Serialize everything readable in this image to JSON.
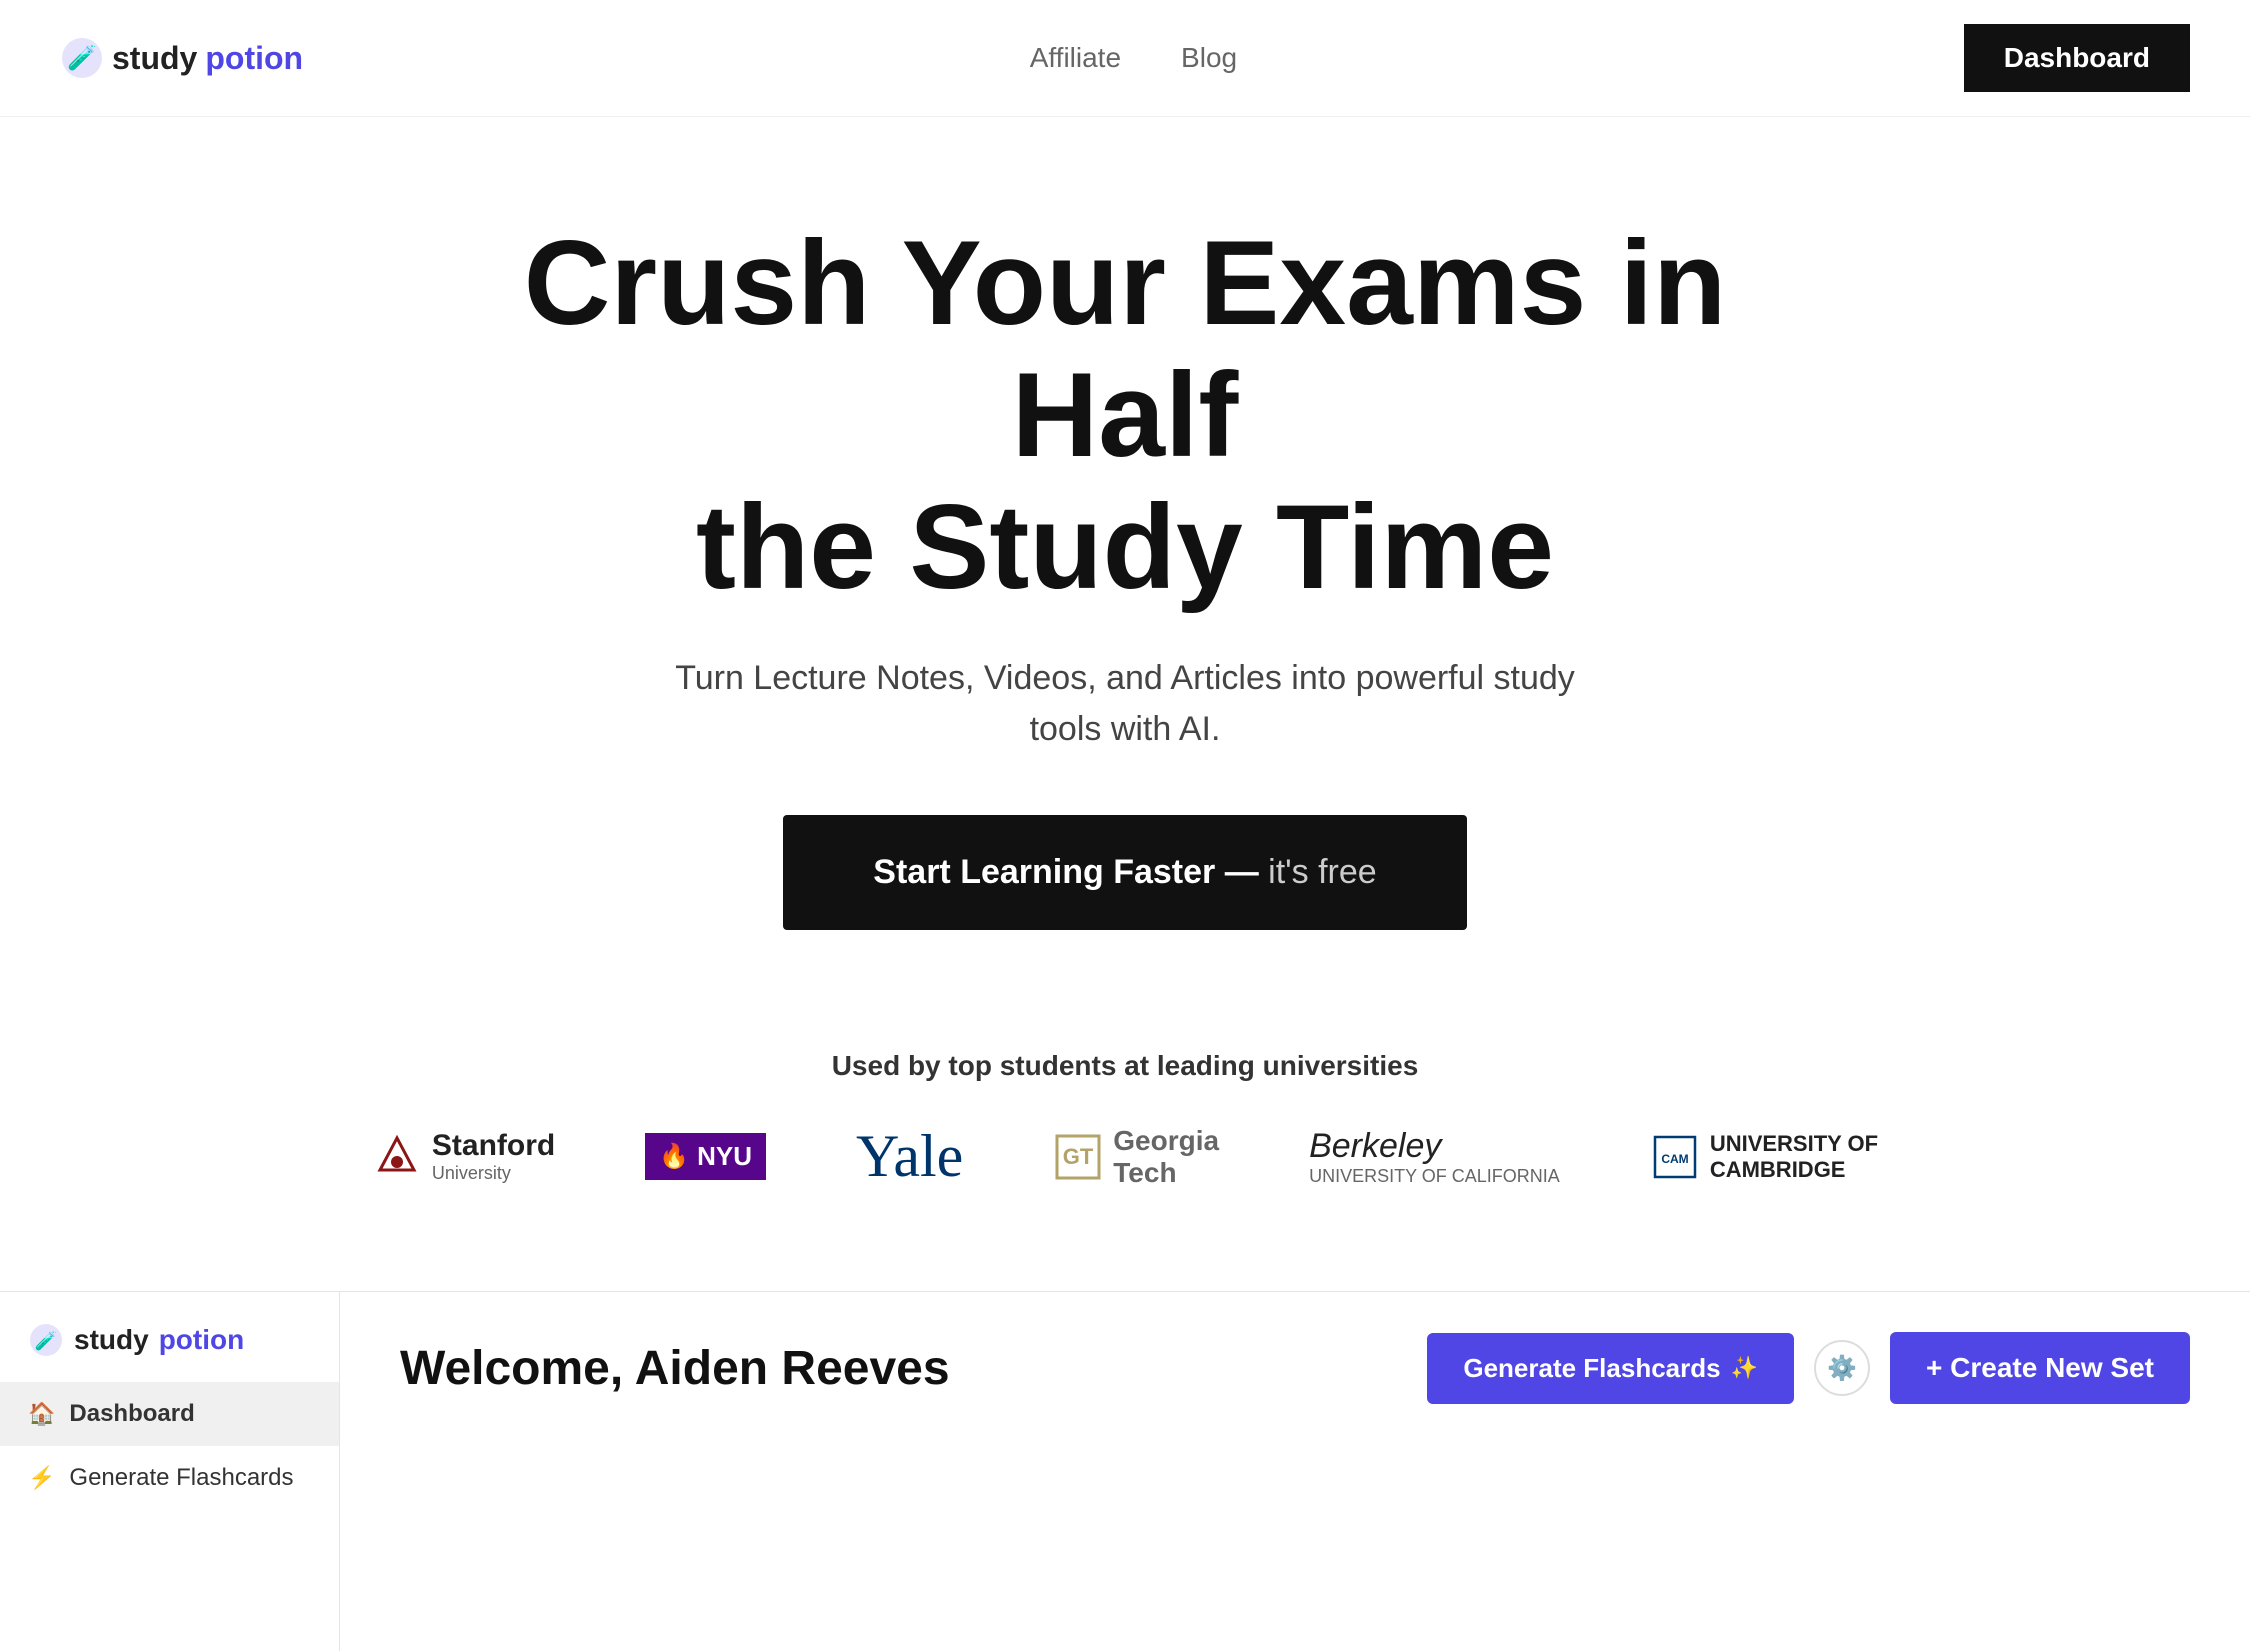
{
  "nav": {
    "logo_study": "study",
    "logo_potion": "potion",
    "link_affiliate": "Affiliate",
    "link_blog": "Blog",
    "dashboard_btn": "Dashboard"
  },
  "hero": {
    "title_line1": "Crush Your Exams in Half",
    "title_line2": "the Study Time",
    "subtitle": "Turn Lecture Notes, Videos, and Articles into powerful study tools with AI.",
    "cta_bold": "Start Learning Faster",
    "cta_separator": " — ",
    "cta_free": "it's free"
  },
  "universities": {
    "label": "Used by top students at leading universities",
    "schools": [
      {
        "name": "Stanford",
        "sub": "University",
        "type": "stanford"
      },
      {
        "name": "NYU",
        "type": "nyu"
      },
      {
        "name": "Yale",
        "type": "yale"
      },
      {
        "name": "Georgia",
        "sub": "Tech",
        "type": "gatech"
      },
      {
        "name": "Berkeley",
        "sub": "UNIVERSITY OF CALIFORNIA",
        "type": "berkeley"
      },
      {
        "name": "UNIVERSITY OF",
        "sub": "CAMBRIDGE",
        "type": "cambridge"
      }
    ]
  },
  "app": {
    "sidebar": {
      "logo_study": "study",
      "logo_potion": "potion",
      "nav_items": [
        {
          "label": "Dashboard",
          "icon": "🏠",
          "active": true
        },
        {
          "label": "Generate Flashcards",
          "icon": "⚡",
          "active": false
        }
      ]
    },
    "main": {
      "welcome_title": "Welcome, Aiden Reeves",
      "generate_btn": "Generate Flashcards",
      "create_btn": "+ Create New Set"
    }
  }
}
